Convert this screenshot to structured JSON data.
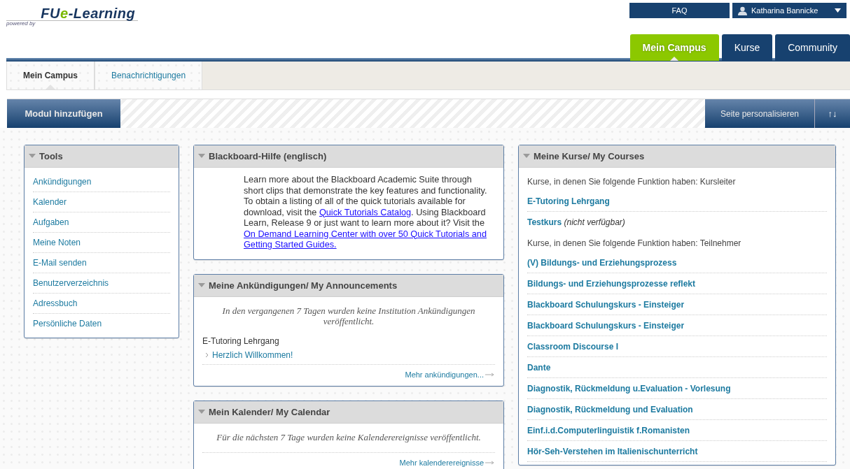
{
  "logo": {
    "powered_by": "powered by",
    "name_start": "FU",
    "name_accent": "e",
    "name_end": "-Learning"
  },
  "top_links": [
    {
      "kind": "link",
      "label": "FAQ"
    },
    {
      "kind": "user",
      "label": "Katharina Bannicke"
    }
  ],
  "main_tabs": [
    {
      "label": "Mein Campus",
      "selected": true
    },
    {
      "label": "Kurse",
      "selected": false
    },
    {
      "label": "Community",
      "selected": false
    }
  ],
  "sub_tabs": [
    {
      "label": "Mein Campus",
      "selected": true
    },
    {
      "label": "Benachrichtigungen",
      "selected": false
    }
  ],
  "toolbar": {
    "add_module": "Modul hinzufügen",
    "personalize": "Seite personalisieren",
    "reorder": "↑↓"
  },
  "columns": [
    [
      {
        "kind": "links",
        "title": "Tools",
        "items": [
          "Ankündigungen",
          "Kalender",
          "Aufgaben",
          "Meine Noten",
          "E-Mail senden",
          "Benutzerverzeichnis",
          "Adressbuch",
          "Persönliche Daten"
        ]
      }
    ],
    [
      {
        "kind": "help",
        "title": "Blackboard-Hilfe (englisch)",
        "parts": [
          {
            "text": "Learn more about the Blackboard Academic Suite through short clips that demonstrate the key features and functionality. To obtain a listing of all of the quick tutorials available for download, visit the "
          },
          {
            "link": "Quick Tutorials Catalog"
          },
          {
            "text": ". Using Blackboard Learn, Release 9 or just want to learn more about it? Visit the "
          },
          {
            "link": "On Demand Learning Center with over 50 Quick Tutorials and Getting Started Guides."
          }
        ]
      },
      {
        "kind": "announcements",
        "title": "Meine Ankündigungen/ My Announcements",
        "notice": "In den vergangenen 7 Tagen wurden keine Institution Ankündigungen veröffentlicht.",
        "course": "E-Tutoring Lehrgang",
        "items": [
          "Herzlich Willkommen!"
        ],
        "more": "Mehr ankündigungen..."
      },
      {
        "kind": "calendar",
        "title": "Mein Kalender/ My Calendar",
        "notice": "Für die nächsten 7 Tage wurden keine Kalenderereignisse veröffentlicht.",
        "more": "Mehr kalenderereignisse"
      }
    ],
    [
      {
        "kind": "courses",
        "title": "Meine Kurse/ My Courses",
        "entries": [
          {
            "kind": "heading",
            "text": "Kurse, in denen Sie folgende Funktion haben: Kursleiter"
          },
          {
            "kind": "course",
            "text": "E-Tutoring Lehrgang"
          },
          {
            "kind": "course",
            "text": "Testkurs",
            "note": "(nicht verfügbar)"
          },
          {
            "kind": "heading",
            "text": "Kurse, in denen Sie folgende Funktion haben: Teilnehmer"
          },
          {
            "kind": "course",
            "text": "(V) Bildungs- und Erziehungsprozess"
          },
          {
            "kind": "course",
            "text": "Bildungs- und Erziehungsprozesse reflekt"
          },
          {
            "kind": "course",
            "text": "Blackboard Schulungskurs - Einsteiger"
          },
          {
            "kind": "course",
            "text": "Blackboard Schulungskurs - Einsteiger"
          },
          {
            "kind": "course",
            "text": "Classroom Discourse I"
          },
          {
            "kind": "course",
            "text": "Dante"
          },
          {
            "kind": "course",
            "text": "Diagnostik, Rückmeldung u.Evaluation - Vorlesung"
          },
          {
            "kind": "course",
            "text": "Diagnostik, Rückmeldung und Evaluation"
          },
          {
            "kind": "course",
            "text": "Einf.i.d.Computerlinguistik f.Romanisten"
          },
          {
            "kind": "course",
            "text": "Hör-Seh-Verstehen im Italienischunterricht"
          }
        ]
      }
    ]
  ]
}
